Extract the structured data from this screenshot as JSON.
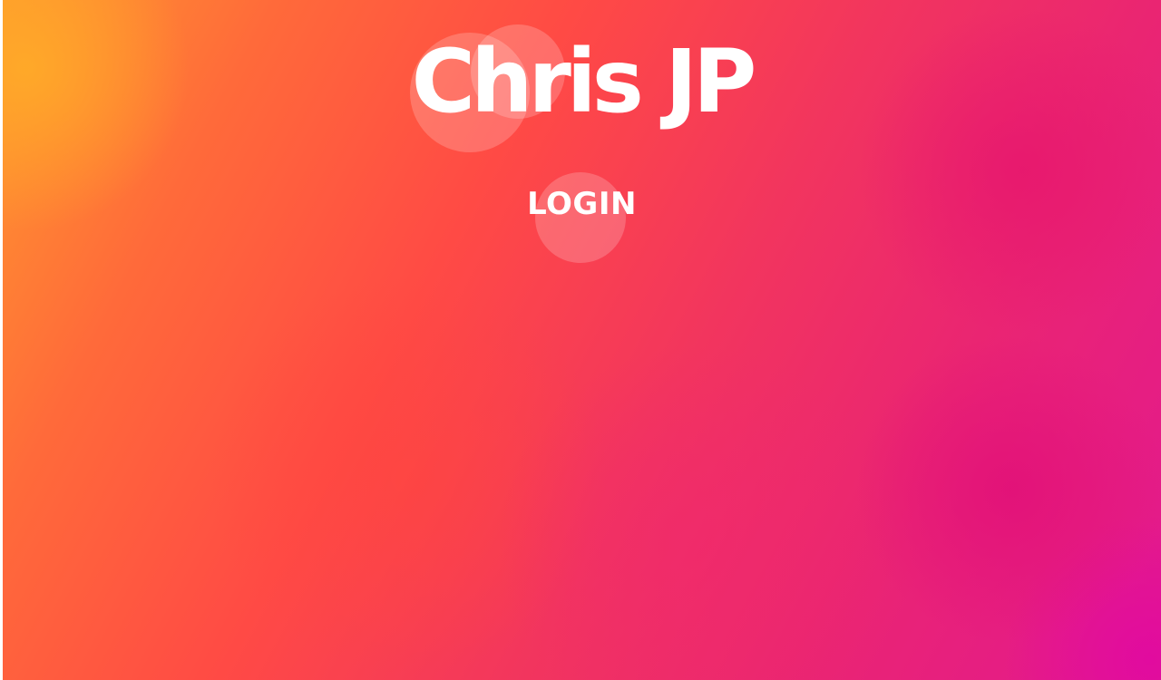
{
  "header": {
    "title": "Chris JP"
  },
  "nav": {
    "login_label": "LOGIN"
  },
  "colors": {
    "gradient_start": "#ff9a2e",
    "gradient_mid": "#f2355e",
    "gradient_end": "#e21890",
    "text": "#ffffff"
  }
}
